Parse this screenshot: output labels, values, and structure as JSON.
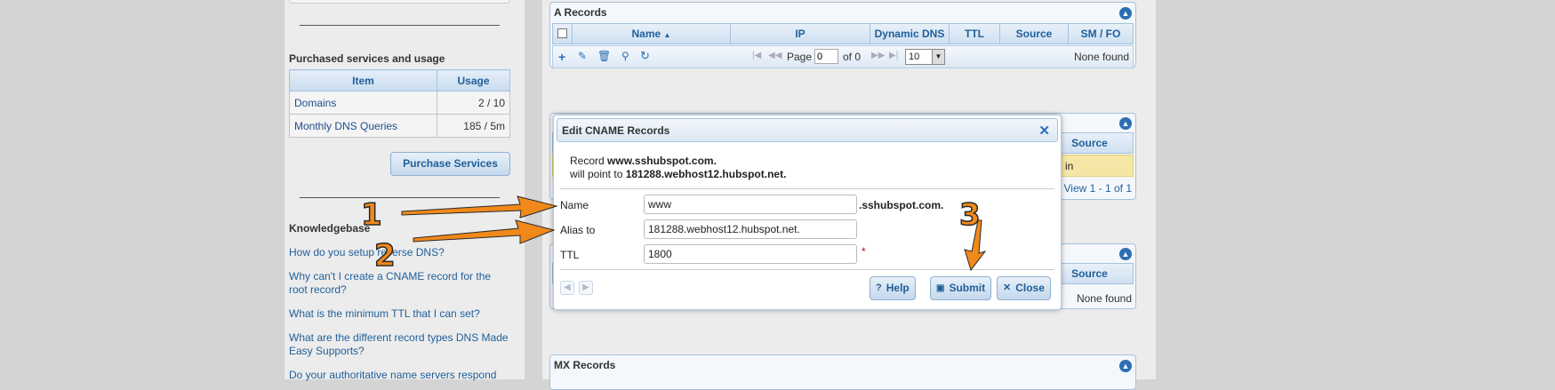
{
  "sidebar": {
    "purchased_title": "Purchased services and usage",
    "table_headers": [
      "Item",
      "Usage"
    ],
    "rows": [
      {
        "item": "Domains",
        "usage": "2 / 10"
      },
      {
        "item": "Monthly DNS Queries",
        "usage": "185 / 5m"
      }
    ],
    "purchase_button": "Purchase Services",
    "kb_title": "Knowledgebase",
    "kb_links": [
      "How do you setup reverse DNS?",
      "Why can't I create a CNAME record for the root record?",
      "What is the minimum TTL that I can set?",
      "What are the different record types DNS Made Easy Supports?",
      "Do your authoritative name servers respond"
    ]
  },
  "a_records": {
    "title": "A Records",
    "columns": [
      "Name",
      "IP",
      "Dynamic DNS",
      "TTL",
      "Source",
      "SM / FO"
    ],
    "pager": {
      "page_label": "Page",
      "page_value": "0",
      "of_label": "of 0",
      "rows_value": "10",
      "empty": "None found"
    }
  },
  "cname_panel": {
    "source_col": "Source",
    "row_value": "in",
    "view_count": "View 1 - 1 of 1"
  },
  "third_panel": {
    "source_col": "Source",
    "empty": "None found"
  },
  "mx_records": {
    "title": "MX Records"
  },
  "dialog": {
    "title": "Edit CNAME Records",
    "desc_prefix": "Record ",
    "record": "www.sshubspot.com.",
    "desc_mid": "will point to ",
    "target": "181288.webhost12.hubspot.net.",
    "name_label": "Name",
    "name_value": "www",
    "name_suffix": ".sshubspot.com.",
    "alias_label": "Alias to",
    "alias_value": "181288.webhost12.hubspot.net.",
    "ttl_label": "TTL",
    "ttl_value": "1800",
    "required_mark": "*",
    "help_button": "Help",
    "submit_button": "Submit",
    "close_button": "Close"
  },
  "callouts": [
    "1",
    "2",
    "3"
  ],
  "colors": {
    "arrow": "#f0891a",
    "accent": "#1f5f9a"
  }
}
